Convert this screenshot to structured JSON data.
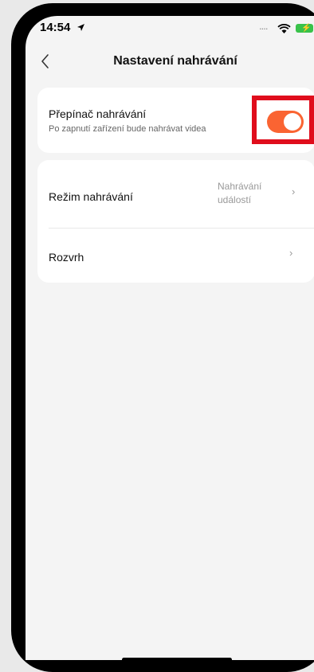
{
  "status_bar": {
    "time": "14:54",
    "signal_dots": "....",
    "battery_color": "#39c24a"
  },
  "header": {
    "title": "Nastavení nahrávání",
    "back_icon": "chevron-left-icon"
  },
  "recording_switch": {
    "title": "Přepínač nahrávání",
    "description": "Po zapnutí zařízení bude nahrávat videa",
    "enabled": true,
    "accent_color": "#fa6432",
    "highlight_color": "#e00d1c"
  },
  "settings": {
    "recording_mode": {
      "label": "Režim nahrávání",
      "value_line1": "Nahrávání",
      "value_line2": "událostí",
      "chevron": "›"
    },
    "schedule": {
      "label": "Rozvrh",
      "chevron": "›"
    }
  }
}
